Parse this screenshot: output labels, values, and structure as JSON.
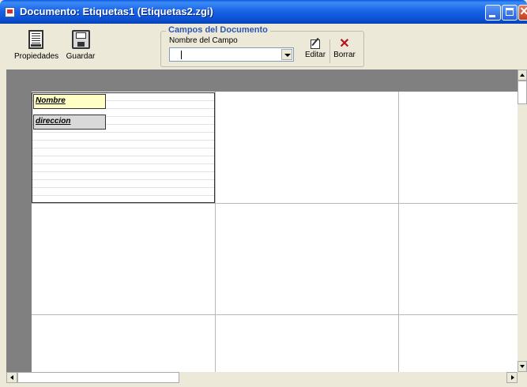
{
  "window": {
    "title": "Documento: Etiquetas1 (Etiquetas2.zgi)"
  },
  "toolbar": {
    "properties_label": "Propiedades",
    "save_label": "Guardar"
  },
  "fields_group": {
    "legend": "Campos del Documento",
    "field_name_label": "Nombre del Campo",
    "field_name_value": "",
    "edit_label": "Editar",
    "delete_label": "Borrar"
  },
  "document": {
    "fields": [
      "Nombre",
      "direccion"
    ]
  },
  "colors": {
    "title_bar": "#0a58e0",
    "group_legend": "#2d57b5",
    "field_nombre_bg": "#ffffc6",
    "field_direccion_bg": "#d9d9d9",
    "workspace_bg": "#808080"
  }
}
